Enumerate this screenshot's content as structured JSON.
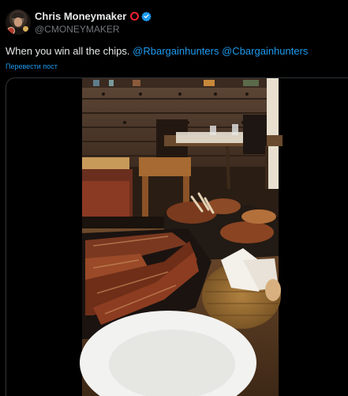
{
  "tweet": {
    "author_name": "Chris Moneymaker",
    "author_handle": "@CMONEYMAKER",
    "text_main": "When you win all the chips.",
    "mention_1": "@Rbargainhunters",
    "mention_2": "@Cbargainhunters",
    "translate_label": "Перевести пост"
  },
  "icons": {
    "ring": "red-ring-icon",
    "verified": "verified-badge-icon"
  },
  "colors": {
    "background": "#000000",
    "text": "#e7e9ea",
    "muted": "#71767b",
    "link": "#1d9bf0",
    "ring": "#f4212e"
  }
}
